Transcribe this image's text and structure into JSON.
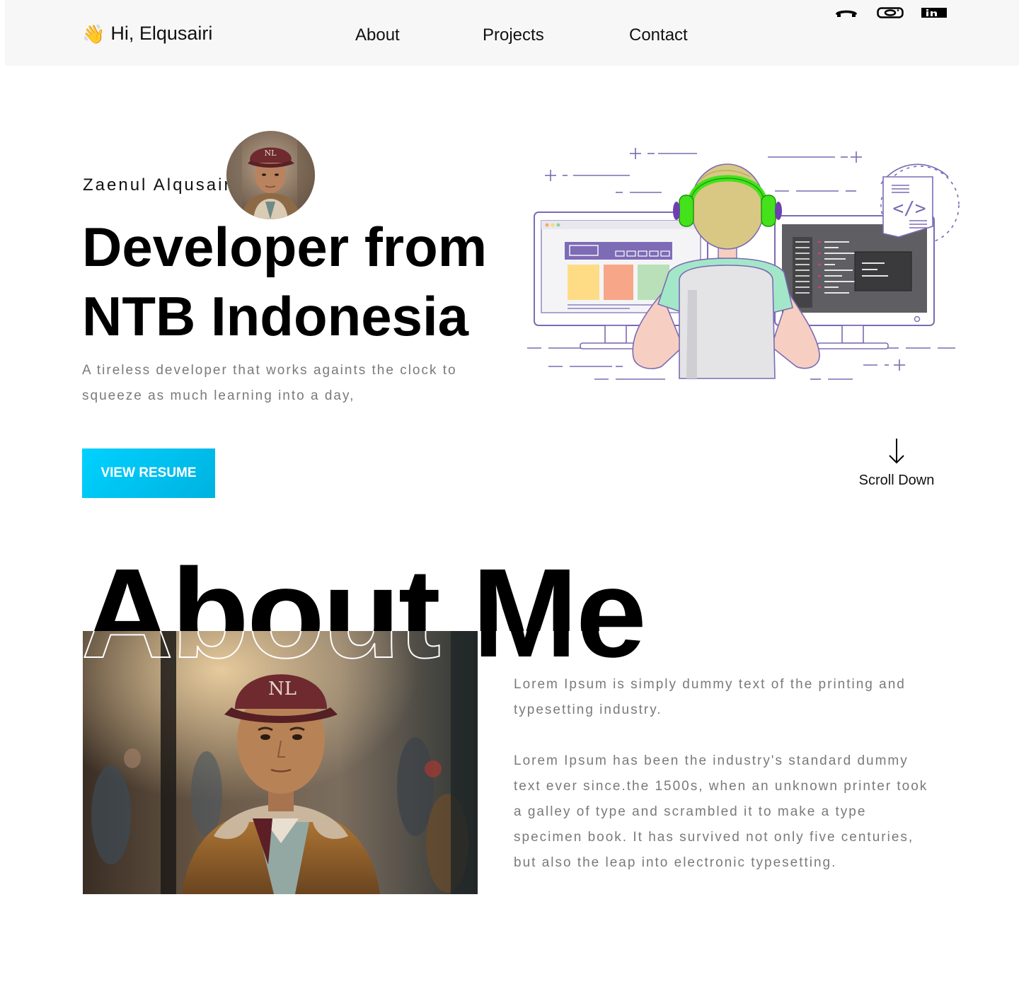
{
  "nav": {
    "brand_emoji": "👋",
    "brand": "Hi, Elqusairi",
    "links": [
      "About",
      "Projects",
      "Contact"
    ],
    "socials": [
      {
        "name": "github",
        "icon": "github-icon"
      },
      {
        "name": "instagram",
        "icon": "instagram-icon"
      },
      {
        "name": "linkedin",
        "icon": "linkedin-icon"
      }
    ]
  },
  "hero": {
    "name": "Zaenul Alqusairi --",
    "title_line1": "Developer from",
    "title_line2_a": "NTB ",
    "title_line2_b": "Indonesia",
    "description": "A tireless developer that works againts the clock to squeeze as much learning into a day,",
    "resume_button": "VIEW RESUME",
    "scroll_label": "Scroll Down",
    "highlight_color": "#f6ff00",
    "button_color": "#00c6f0"
  },
  "about": {
    "heading": "About Me",
    "paragraph1": "Lorem Ipsum is simply dummy text of the printing and typesetting industry.",
    "paragraph2": "Lorem Ipsum has been the industry's standard dummy text ever since.the 1500s, when an unknown printer took a galley of type and scrambled it to make a type specimen book. It has survived not only five centuries, but also the leap into electronic typesetting."
  }
}
